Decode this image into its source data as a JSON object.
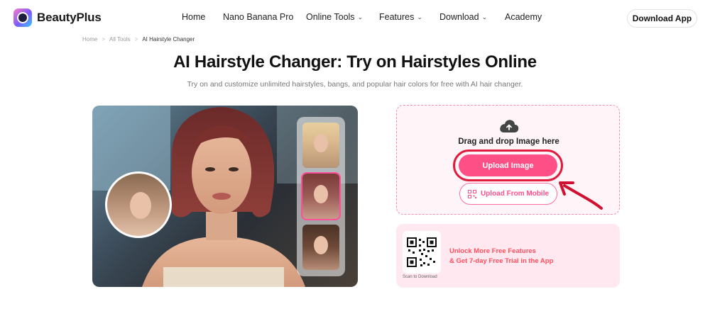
{
  "brand": {
    "name": "BeautyPlus"
  },
  "nav": [
    {
      "label": "Home",
      "has_dropdown": false
    },
    {
      "label": "Nano Banana Pro",
      "has_dropdown": false
    },
    {
      "label": "Online Tools",
      "has_dropdown": true
    },
    {
      "label": "Features",
      "has_dropdown": true
    },
    {
      "label": "Download",
      "has_dropdown": true
    },
    {
      "label": "Academy",
      "has_dropdown": false
    }
  ],
  "header": {
    "download_app_label": "Download App"
  },
  "breadcrumb": {
    "home": "Home",
    "all_tools": "All Tools",
    "separator": ">",
    "current": "AI Hairstyle Changer"
  },
  "page": {
    "title": "AI Hairstyle Changer: Try on Hairstyles Online",
    "subtitle": "Try on and customize unlimited hairstyles, bangs, and popular hair colors for free with AI hair changer."
  },
  "upload": {
    "drag_text": "Drag and drop Image here",
    "upload_button": "Upload Image",
    "mobile_button": "Upload From Mobile"
  },
  "promo": {
    "line1": "Unlock More Free Features",
    "line2": "& Get 7-day Free Trial in the App",
    "scan_label": "Scan to Download"
  },
  "colors": {
    "accent_pink": "#ff4f87",
    "highlight_red": "#e01b3c",
    "promo_text": "#ff4f5e"
  }
}
